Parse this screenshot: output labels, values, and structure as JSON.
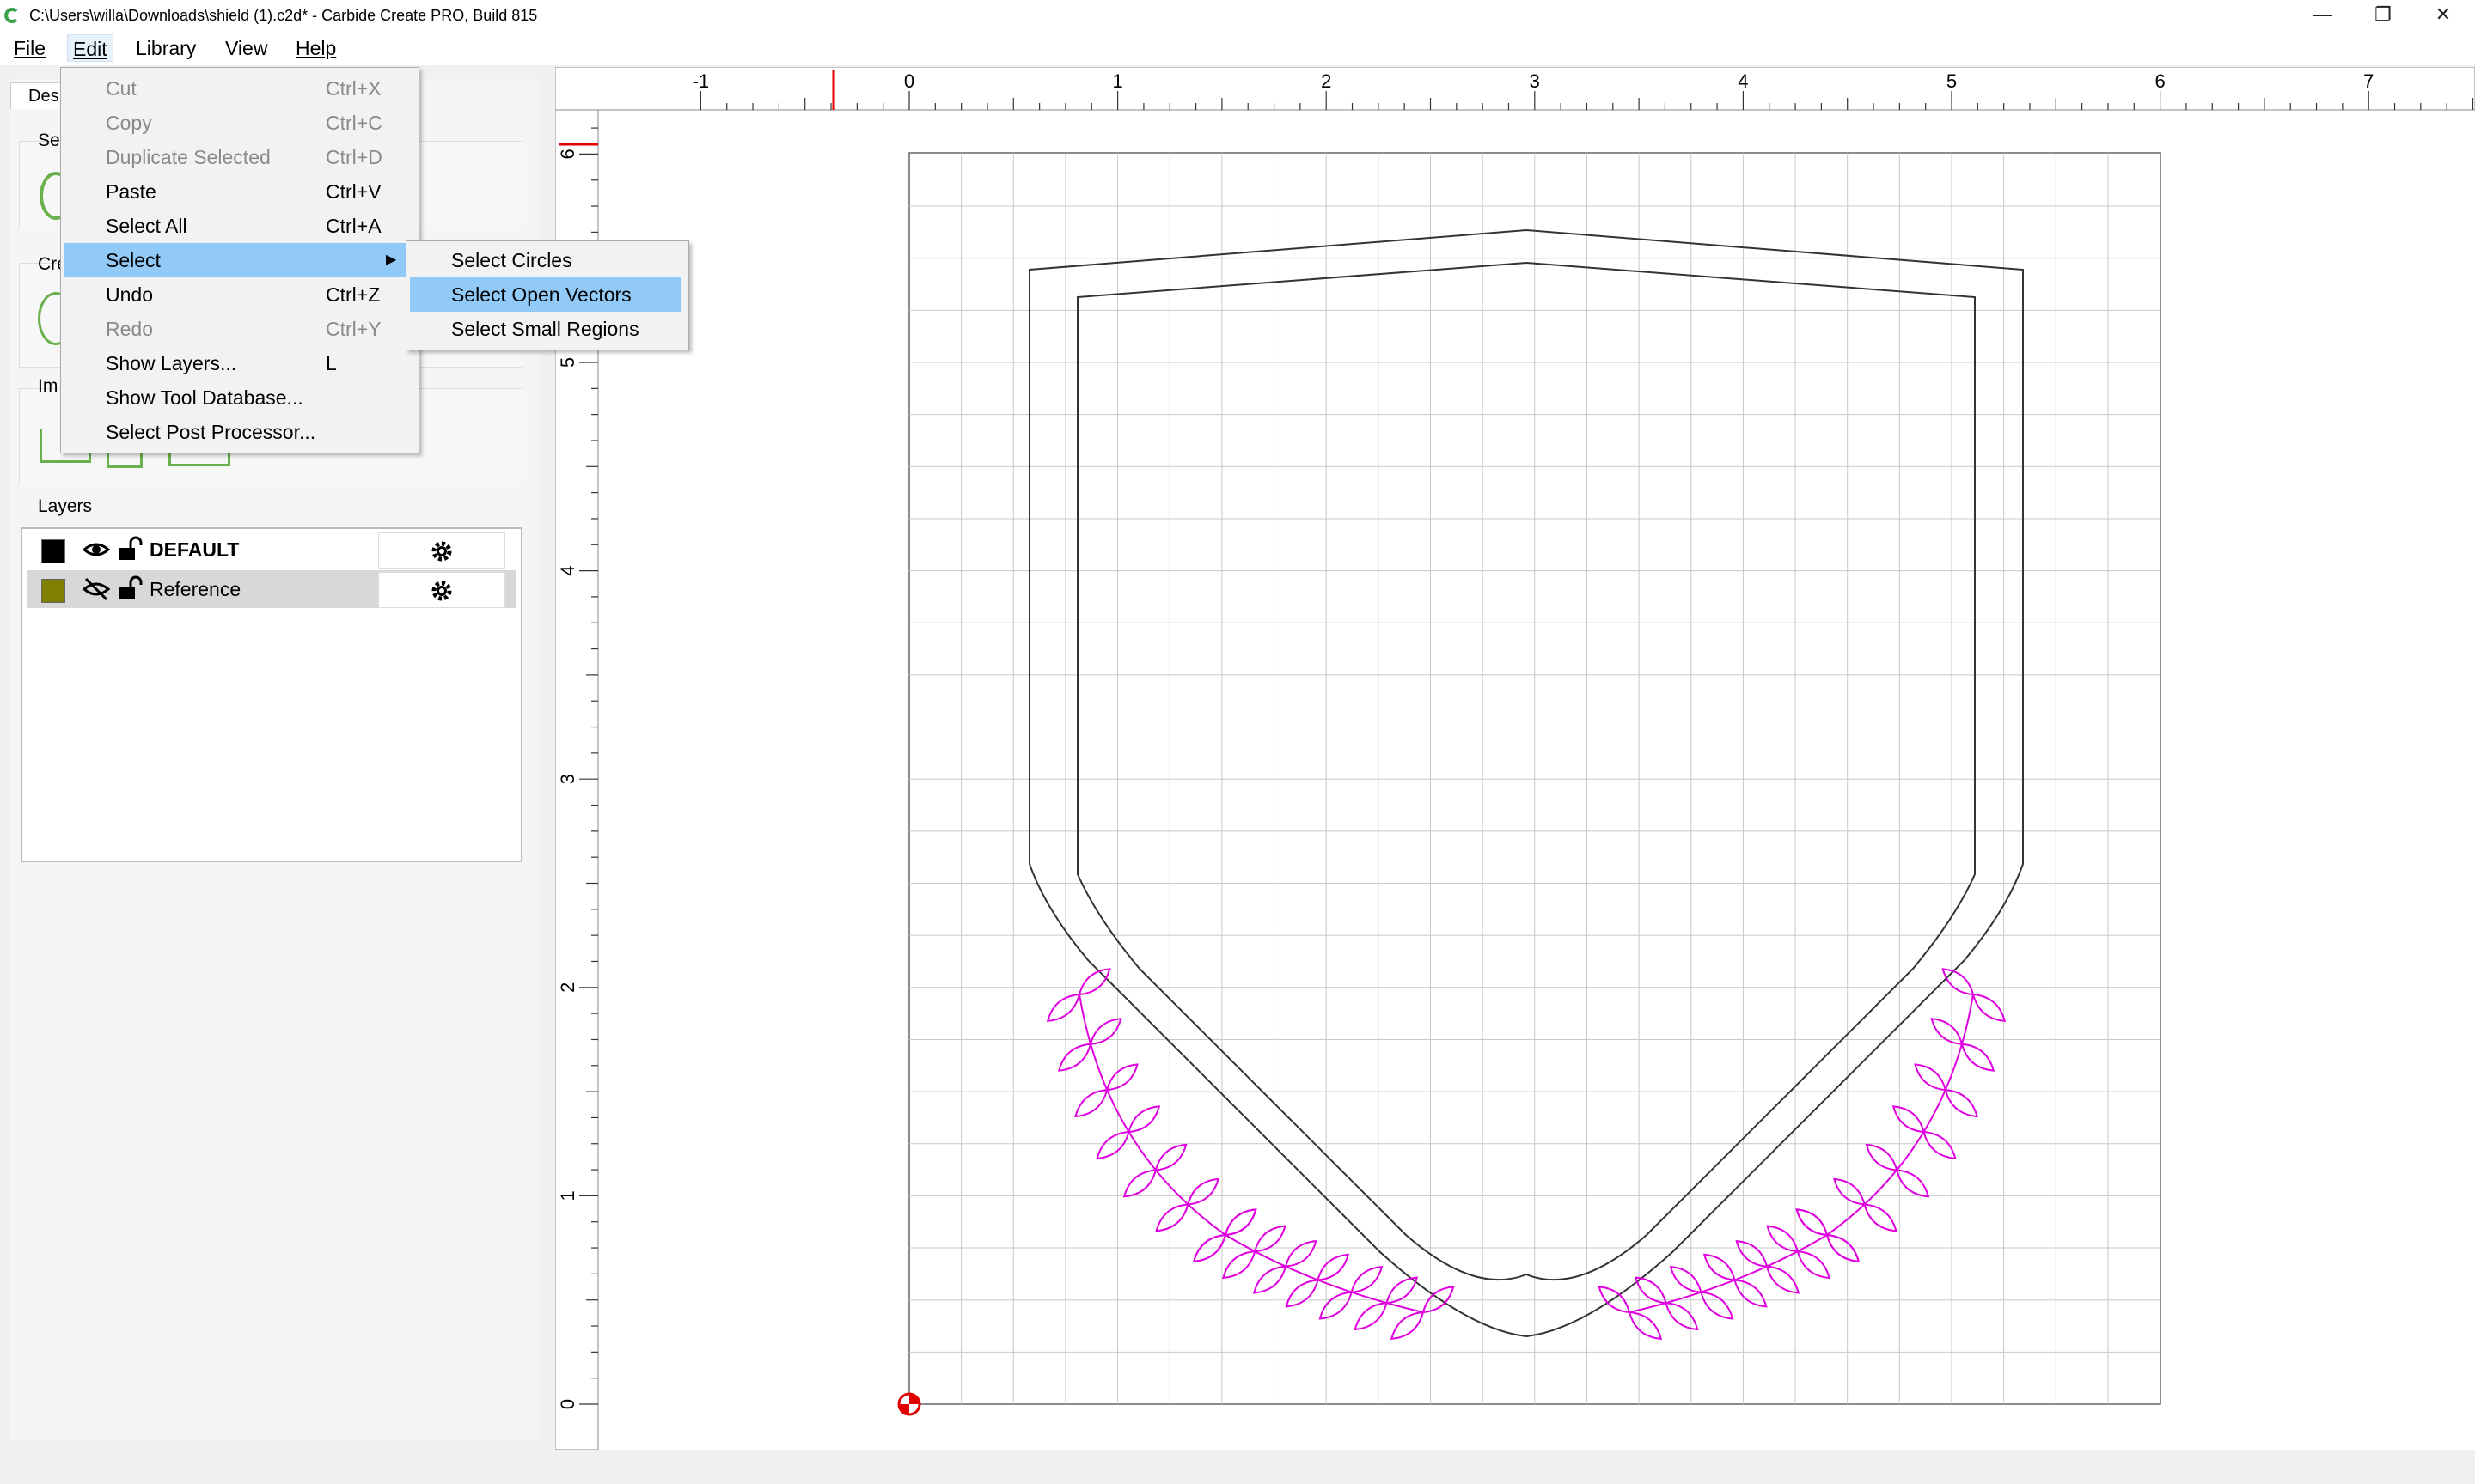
{
  "window": {
    "title": "C:\\Users\\willa\\Downloads\\shield (1).c2d* - Carbide Create PRO, Build 815",
    "minimize": "—",
    "maximize": "❐",
    "close": "✕"
  },
  "menubar": {
    "items": [
      {
        "label": "File"
      },
      {
        "label": "Edit"
      },
      {
        "label": "Library"
      },
      {
        "label": "View"
      },
      {
        "label": "Help"
      }
    ]
  },
  "leftpanel": {
    "tab_label": "Des",
    "section_labels": [
      "Se",
      "Cre",
      "Im"
    ],
    "layers_label": "Layers",
    "layers": [
      {
        "name": "DEFAULT",
        "color": "#000000",
        "visible": true,
        "locked": false,
        "bold": true
      },
      {
        "name": "Reference",
        "color": "#808000",
        "visible": false,
        "locked": false,
        "bold": false
      }
    ]
  },
  "edit_menu": {
    "items": [
      {
        "label": "Cut",
        "shortcut": "Ctrl+X",
        "enabled": false
      },
      {
        "label": "Copy",
        "shortcut": "Ctrl+C",
        "enabled": false
      },
      {
        "label": "Duplicate Selected",
        "shortcut": "Ctrl+D",
        "enabled": false
      },
      {
        "label": "Paste",
        "shortcut": "Ctrl+V",
        "enabled": true
      },
      {
        "label": "Select All",
        "shortcut": "Ctrl+A",
        "enabled": true
      },
      {
        "label": "Select",
        "shortcut": "",
        "enabled": true,
        "submenu": true,
        "highlighted": true
      },
      {
        "label": "Undo",
        "shortcut": "Ctrl+Z",
        "enabled": true
      },
      {
        "label": "Redo",
        "shortcut": "Ctrl+Y",
        "enabled": false
      },
      {
        "label": "Show Layers...",
        "shortcut": "L",
        "enabled": true
      },
      {
        "label": "Show Tool Database...",
        "shortcut": "",
        "enabled": true
      },
      {
        "label": "Select Post Processor...",
        "shortcut": "",
        "enabled": true
      }
    ]
  },
  "select_submenu": {
    "items": [
      {
        "label": "Select Circles",
        "highlighted": false
      },
      {
        "label": "Select Open Vectors",
        "highlighted": true
      },
      {
        "label": "Select Small Regions",
        "highlighted": false
      }
    ]
  },
  "canvas": {
    "h_ruler_labels": [
      "-1",
      "0",
      "1",
      "2",
      "3",
      "4",
      "5",
      "6",
      "7"
    ],
    "v_ruler_labels": [
      "6",
      "5",
      "4",
      "3",
      "2",
      "1",
      "0"
    ],
    "colors": {
      "grid": "#c8c8c8",
      "vector": "#333333",
      "reference": "#e000e0",
      "ruler_marker": "#e00000"
    }
  }
}
